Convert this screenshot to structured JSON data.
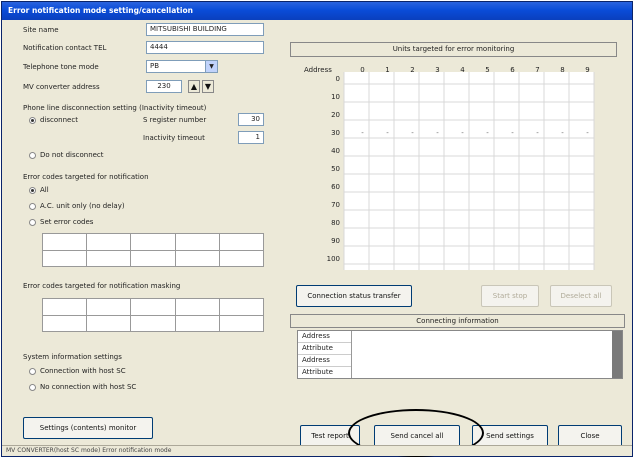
{
  "window": {
    "title": "Error notification mode setting/cancellation"
  },
  "left": {
    "site_name": {
      "label": "Site name",
      "value": "MITSUBISHI BUILDING"
    },
    "notification_tel": {
      "label": "Notification contact TEL",
      "value": "4444"
    },
    "telephone_tone": {
      "label": "Telephone tone mode",
      "value": "PB"
    },
    "mv_address": {
      "label": "MV converter address",
      "value": "230"
    },
    "phone_disconnect": {
      "heading": "Phone line disconnection setting (Inactivity timeout)",
      "disconnect_label": "disconnect",
      "disconnect_selected": true,
      "register_label": "S register number",
      "register_value": "30",
      "inactivity_label": "Inactivity timeout",
      "inactivity_value": "1",
      "no_disconnect_label": "Do not disconnect"
    },
    "error_codes": {
      "heading": "Error codes targeted for notification",
      "options": [
        {
          "label": "All",
          "selected": true
        },
        {
          "label": "A.C. unit only (no delay)",
          "selected": false
        },
        {
          "label": "Set error codes",
          "selected": false
        }
      ]
    },
    "error_codes_masking": {
      "heading": "Error codes targeted for notification masking"
    },
    "system_info": {
      "heading": "System information settings",
      "options": [
        {
          "label": "Connection with host SC",
          "selected": false
        },
        {
          "label": "No connection with host SC",
          "selected": false
        }
      ]
    },
    "settings_button": "Settings (contents) monitor"
  },
  "right": {
    "units_panel_title": "Units targeted for error monitoring",
    "address_header": "Address",
    "col_headers": [
      "0",
      "1",
      "2",
      "3",
      "4",
      "5",
      "6",
      "7",
      "8",
      "9"
    ],
    "row_headers": [
      "0",
      "10",
      "20",
      "30",
      "40",
      "50",
      "60",
      "70",
      "80",
      "90",
      "100"
    ],
    "marked_row": "30",
    "connection_status_button": "Connection status transfer",
    "start_button": "Start stop",
    "deselect_button": "Deselect all",
    "connecting_title": "Connecting information",
    "connecting_rows": [
      "Address",
      "Attribute",
      "Address",
      "Attribute"
    ]
  },
  "bottom": {
    "test_button": "Test report",
    "send_cancel_button": "Send cancel all",
    "send_settings_button": "Send settings",
    "close_button": "Close"
  },
  "status_bar": "MV CONVERTER(host SC mode) Error notification mode"
}
